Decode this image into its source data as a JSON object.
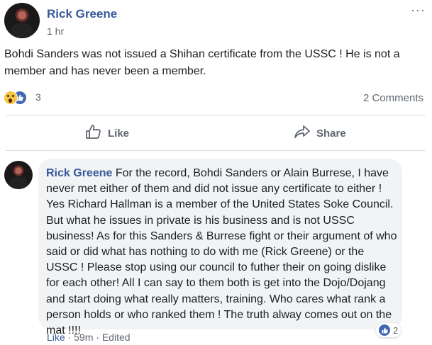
{
  "post": {
    "author": "Rick Greene",
    "time": "1 hr",
    "body": "Bohdi Sanders was not issued a Shihan certificate from the USSC ! He is not a member and has never been a member.",
    "reaction_count": "3",
    "comments_count": "2 Comments"
  },
  "actions": {
    "like_label": "Like",
    "share_label": "Share"
  },
  "comment": {
    "author": "Rick Greene",
    "text": "For the record, Bohdi Sanders or Alain Burrese, I have never met either of them and did not issue any certificate to either ! Yes Richard Hallman is a member of the United States Soke Council. But what he issues in private is his business and is not USSC business! As for this Sanders & Burrese fight or their argument of who said or did what has nothing to do with me (Rick Greene) or the USSC ! Please stop using our council to futher their on going dislike for each other! All I can say to them both is get into the Dojo/Dojang and start doing what really matters, training. Who cares what rank a person holds or who ranked them ! The truth alway comes out on the mat !!!!",
    "reaction_count": "2",
    "like_label": "Like",
    "time": "59m",
    "edited_label": "Edited",
    "separator": "·"
  },
  "colors": {
    "name_blue": "#365899",
    "like_blue": "#4267b2",
    "meta_gray": "#606770",
    "bubble_bg": "#f2f3f5"
  },
  "icons": [
    "wow-reaction-icon",
    "like-reaction-icon",
    "thumbs-up-icon",
    "share-arrow-icon",
    "more-options-icon"
  ]
}
